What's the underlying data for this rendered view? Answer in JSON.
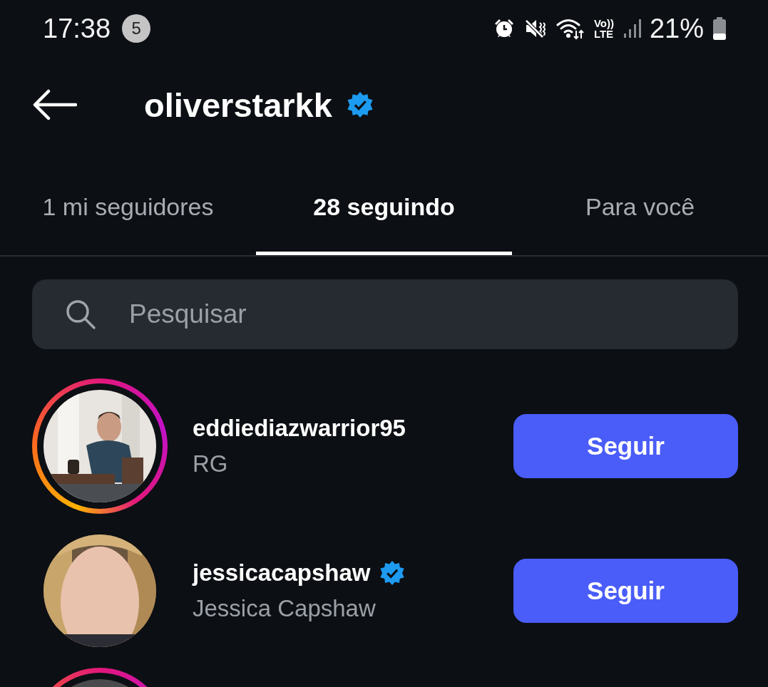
{
  "status_bar": {
    "time": "17:38",
    "notification_count": "5",
    "network_labels": [
      "Vo))",
      "LTE"
    ],
    "battery": "21%"
  },
  "header": {
    "title": "oliverstarkk",
    "verified": true
  },
  "tabs": [
    {
      "label": "1 mi seguidores",
      "selected": false
    },
    {
      "label": "28 seguindo",
      "selected": true
    },
    {
      "label": "Para você",
      "selected": false
    }
  ],
  "search": {
    "placeholder": "Pesquisar"
  },
  "users": [
    {
      "username": "eddiediazwarrior95",
      "name": "RG",
      "verified": false,
      "story_ring": true,
      "button": "Seguir"
    },
    {
      "username": "jessicacapshaw",
      "name": "Jessica Capshaw",
      "verified": true,
      "story_ring": false,
      "button": "Seguir"
    },
    {
      "story_ring": true
    }
  ]
}
